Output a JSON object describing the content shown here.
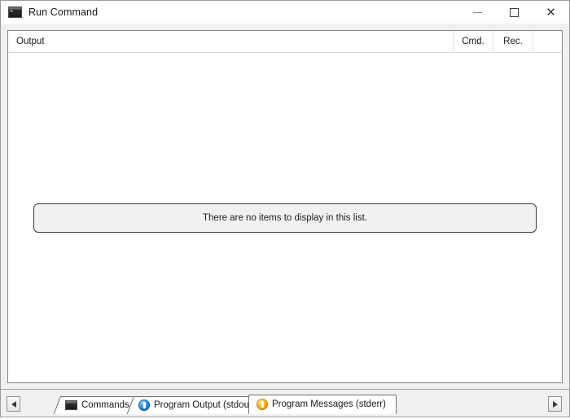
{
  "window": {
    "title": "Run Command",
    "icon": "console-icon",
    "controls": {
      "minimize": "minimize-icon",
      "maximize": "maximize-icon",
      "close": "close-icon"
    }
  },
  "listview": {
    "columns": [
      {
        "label": "Output",
        "align": "left"
      },
      {
        "label": "Cmd.",
        "align": "center"
      },
      {
        "label": "Rec.",
        "align": "center"
      }
    ],
    "rows": [],
    "empty_message": "There are no items to display in this list."
  },
  "tabstrip": {
    "scroll_left": "triangle-left-icon",
    "scroll_right": "triangle-right-icon",
    "tabs": [
      {
        "label": "Commands",
        "icon": "console-icon",
        "selected": false
      },
      {
        "label": "Program Output (stdout)",
        "icon": "info-circle-icon",
        "selected": false
      },
      {
        "label": "Program Messages (stderr)",
        "icon": "warning-circle-icon",
        "selected": true
      }
    ]
  },
  "colors": {
    "window_background": "#f0f0f0",
    "titlebar_background": "#ffffff",
    "listview_background": "#ffffff",
    "empty_box_fill": "#f1f1f1",
    "border": "#848484",
    "info_icon": "#2a8fe0",
    "warning_icon": "#f9b521",
    "text": "#1a1a1a"
  }
}
